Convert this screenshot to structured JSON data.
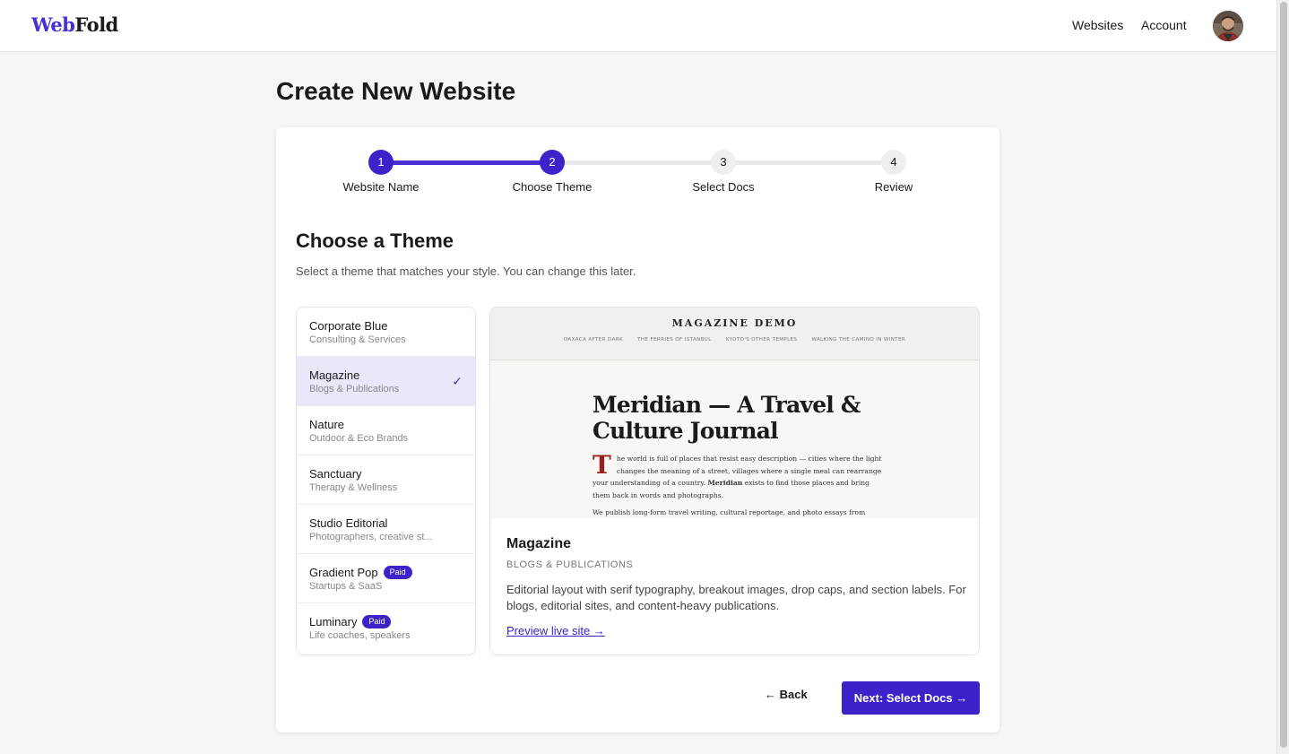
{
  "header": {
    "logo_part1": "Web",
    "logo_part2": "Fold",
    "nav": {
      "websites": "Websites",
      "account": "Account"
    }
  },
  "page": {
    "title": "Create New Website"
  },
  "stepper": {
    "steps": [
      {
        "number": "1",
        "label": "Website Name",
        "state": "done"
      },
      {
        "number": "2",
        "label": "Choose Theme",
        "state": "active"
      },
      {
        "number": "3",
        "label": "Select Docs",
        "state": "todo"
      },
      {
        "number": "4",
        "label": "Review",
        "state": "todo"
      }
    ]
  },
  "section": {
    "title": "Choose a Theme",
    "subtitle": "Select a theme that matches your style. You can change this later."
  },
  "themes": [
    {
      "name": "Corporate Blue",
      "category": "Consulting & Services"
    },
    {
      "name": "Magazine",
      "category": "Blogs & Publications",
      "selected": true
    },
    {
      "name": "Nature",
      "category": "Outdoor & Eco Brands"
    },
    {
      "name": "Sanctuary",
      "category": "Therapy & Wellness"
    },
    {
      "name": "Studio Editorial",
      "category": "Photographers, creative st..."
    },
    {
      "name": "Gradient Pop",
      "category": "Startups & SaaS",
      "badge": "Paid"
    },
    {
      "name": "Luminary",
      "category": "Life coaches, speakers",
      "badge": "Paid"
    }
  ],
  "preview": {
    "image": {
      "brand": "MAGAZINE DEMO",
      "nav": [
        "OAXACA AFTER DARK",
        "THE FERRIES OF ISTANBUL",
        "KYOTO'S OTHER TEMPLES",
        "WALKING THE CAMINO IN WINTER"
      ],
      "headline": "Meridian — A Travel & Culture Journal",
      "drop_cap": "T",
      "body_start": "he world is full of places that resist easy description — cities where the light changes the meaning of a street, villages where a single meal can rearrange your understanding of a country. ",
      "body_bold": "Meridian",
      "body_end": " exists to find those places and bring them back in words and photographs.",
      "body2": "We publish long-form travel writing, cultural reportage, and photo essays from"
    },
    "name": "Magazine",
    "category": "BLOGS & PUBLICATIONS",
    "description": "Editorial layout with serif typography, breakout images, drop caps, and section labels. For blogs, editorial sites, and content-heavy publications.",
    "link": "Preview live site →"
  },
  "actions": {
    "back": "← Back",
    "next": "Next: Select Docs →"
  },
  "colors": {
    "accent": "#3b22c9",
    "selected_bg": "#ebe7fb",
    "drop_cap": "#9b1f1f"
  }
}
